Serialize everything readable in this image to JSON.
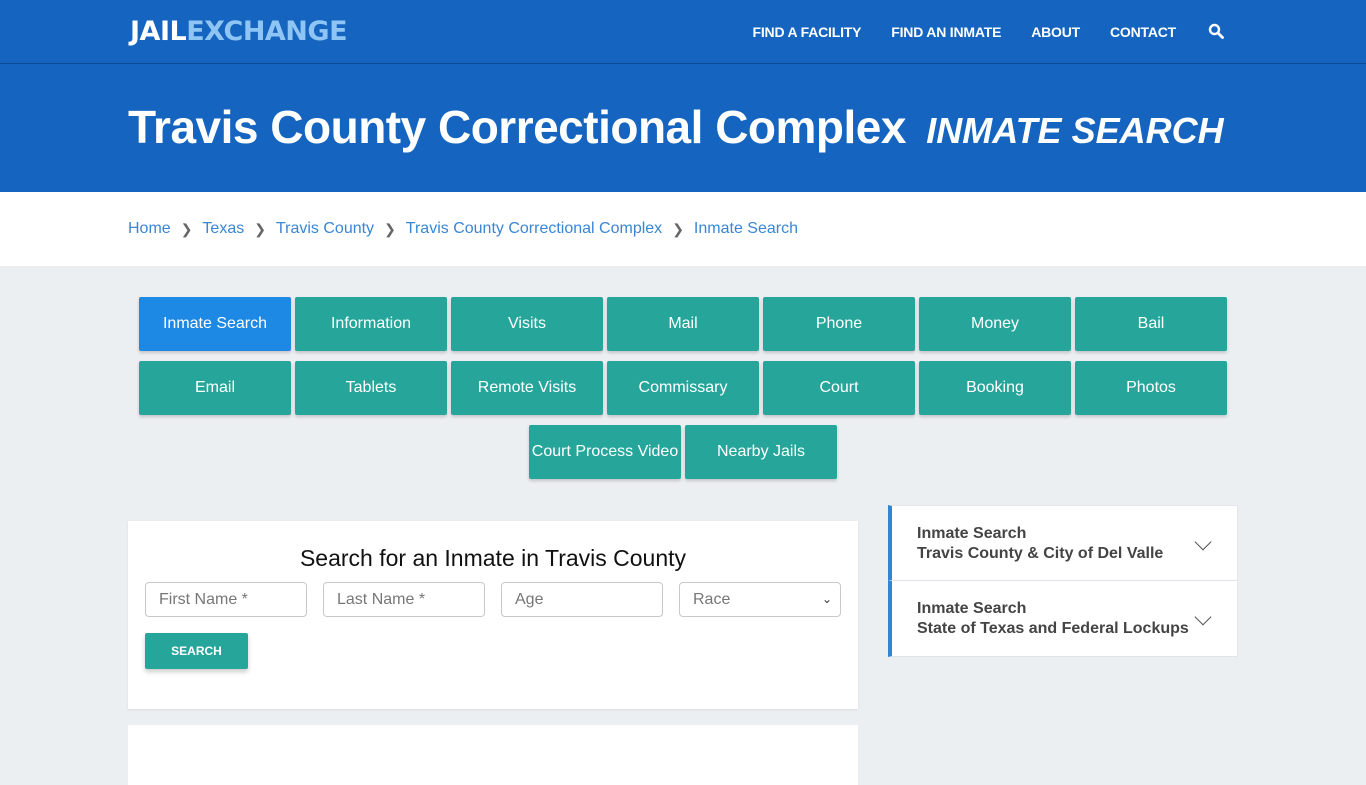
{
  "header": {
    "logo_part1": "JAIL",
    "logo_part2": "EXCHANGE",
    "nav": [
      "FIND A FACILITY",
      "FIND AN INMATE",
      "ABOUT",
      "CONTACT"
    ],
    "search_icon": "search-icon"
  },
  "hero": {
    "title": "Travis County Correctional Complex",
    "subtitle": "INMATE SEARCH"
  },
  "breadcrumb": [
    "Home",
    "Texas",
    "Travis County",
    "Travis County Correctional Complex",
    "Inmate Search"
  ],
  "tabs": {
    "row1": [
      "Inmate Search",
      "Information",
      "Visits",
      "Mail",
      "Phone",
      "Money",
      "Bail"
    ],
    "row2": [
      "Email",
      "Tablets",
      "Remote Visits",
      "Commissary",
      "Court",
      "Booking",
      "Photos"
    ],
    "row3": [
      "Court Process Video",
      "Nearby Jails"
    ],
    "active": "Inmate Search",
    "colors": {
      "active": "#1e88e5",
      "default": "#26a69a"
    }
  },
  "search_form": {
    "title": "Search for an Inmate in Travis County",
    "first_name_placeholder": "First Name *",
    "last_name_placeholder": "Last Name *",
    "age_placeholder": "Age",
    "race_selected": "Race",
    "button": "SEARCH"
  },
  "sidebar": {
    "items": [
      {
        "line1": "Inmate Search",
        "line2": "Travis County & City of Del Valle"
      },
      {
        "line1": "Inmate Search",
        "line2": "State of Texas and Federal Lockups"
      }
    ]
  },
  "colors": {
    "brand_blue": "#1565c0",
    "teal": "#26a69a",
    "link": "#3a86d4"
  }
}
